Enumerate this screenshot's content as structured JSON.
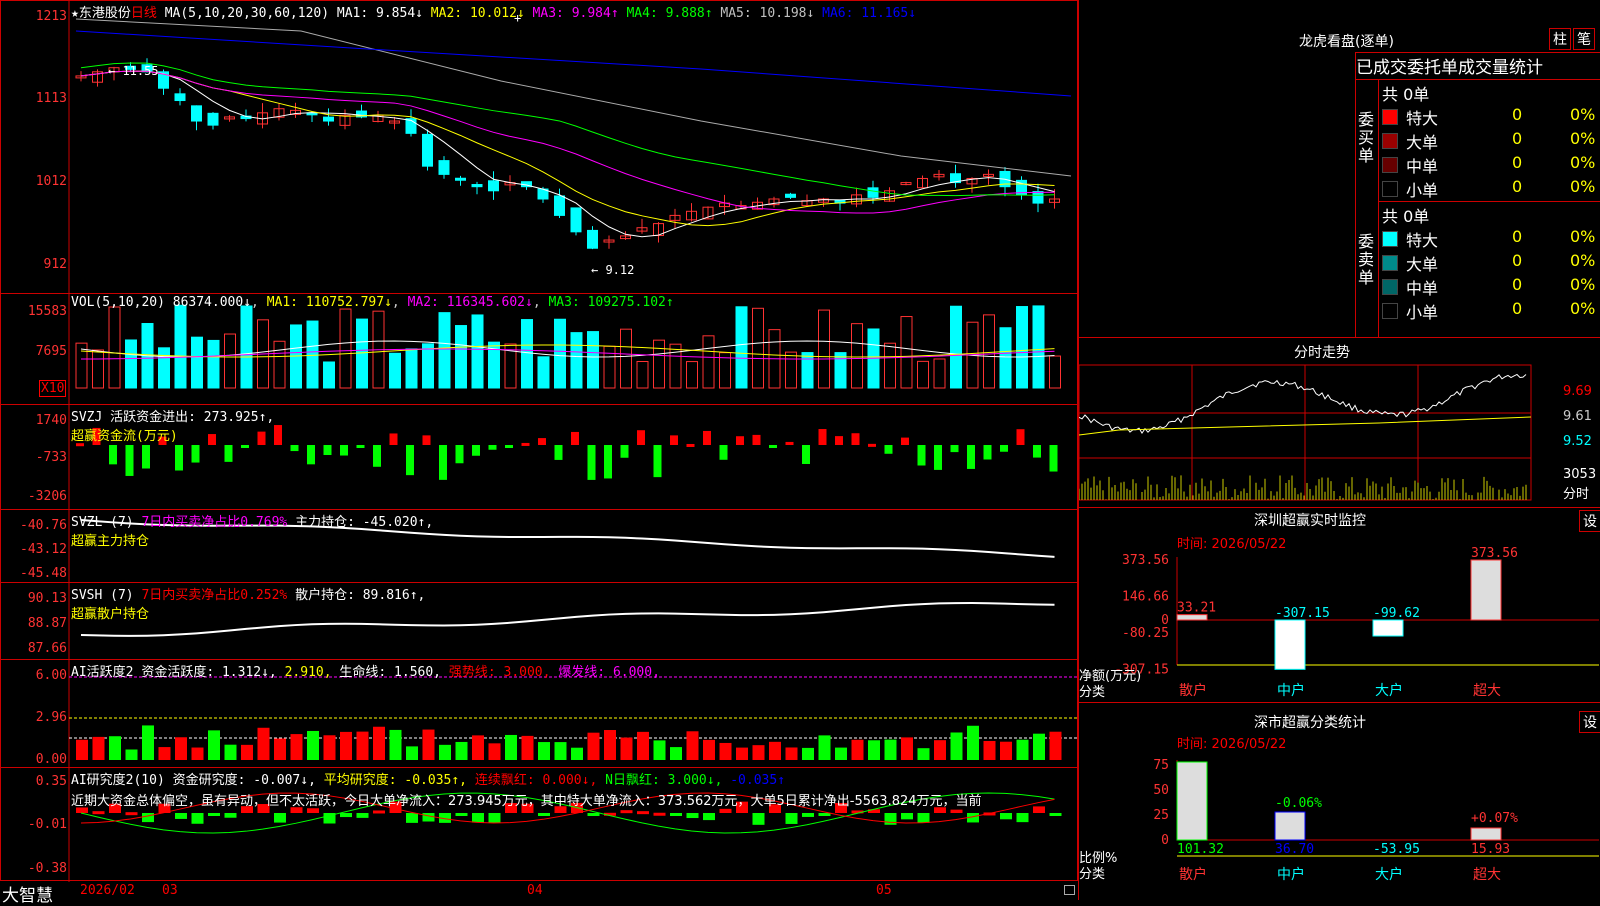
{
  "main": {
    "stock_name": "东港股份",
    "period": "日线",
    "ma_label": "MA(5,10,20,30,60,120)",
    "ma": [
      {
        "name": "MA1:",
        "value": "9.854↓",
        "color": "#ffffff"
      },
      {
        "name": "MA2:",
        "value": "10.012↓",
        "color": "#ffff00"
      },
      {
        "name": "MA3:",
        "value": "9.984↑",
        "color": "#ff00ff"
      },
      {
        "name": "MA4:",
        "value": "9.888↑",
        "color": "#00ff00"
      },
      {
        "name": "MA5:",
        "value": "10.198↓",
        "color": "#c0c0c0"
      },
      {
        "name": "MA6:",
        "value": "11.165↓",
        "color": "#0000ff"
      }
    ],
    "yticks": [
      "1213",
      "1113",
      "1012",
      "912"
    ],
    "high_label": "11.55",
    "low_label": "9.12"
  },
  "vol": {
    "label": "VOL(5,10,20)",
    "value": "86374.000↓",
    "ma1": "MA1: 110752.797↓",
    "ma2": "MA2: 116345.602↓",
    "ma3": "MA3: 109275.102↑",
    "yticks": [
      "15583",
      "7695"
    ],
    "unit": "X10"
  },
  "svzj": {
    "label": "SVZJ",
    "text": "活跃资金进出: 273.925↑,",
    "sub": "超赢资金流(万元)",
    "yticks": [
      "1740",
      "-733",
      "-3206"
    ]
  },
  "svzl": {
    "label": "SVZL (7)",
    "text1": "7日内买卖净占比0.769%",
    "text2": "主力持仓: -45.020↑,",
    "sub": "超赢主力持仓",
    "yticks": [
      "-40.76",
      "-43.12",
      "-45.48"
    ]
  },
  "svsh": {
    "label": "SVSH (7)",
    "text1": "7日内买卖净占比0.252%",
    "text2": "散户持仓: 89.816↑,",
    "sub": "超赢散户持仓",
    "yticks": [
      "90.13",
      "88.87",
      "87.66"
    ]
  },
  "ai1": {
    "label": "AI活跃度2",
    "t1": "资金活跃度: 1.312↓,",
    "t2": "2.910,",
    "t3": "生命线: 1.560,",
    "t4": "强势线: 3.000,",
    "t5": "爆发线: 6.000,",
    "yticks": [
      "6.00",
      "2.96",
      "0.00"
    ]
  },
  "ai2": {
    "label": "AI研究度2(10)",
    "t1": "资金研究度: -0.007↓,",
    "t2": "平均研究度: -0.035↑,",
    "t3": "连续飘红: 0.000↓,",
    "t4": "N日飘红: 3.000↓,",
    "t5": "-0.035↑",
    "desc": "近期大资金总体偏空，虽有异动，但不太活跃，今日大单净流入：273.945万元，其中特大单净流入：373.562万元，大单5日累计净出-5563.824万元，当前",
    "yticks": [
      "0.35",
      "-0.01",
      "-0.38"
    ]
  },
  "bottom": {
    "brand": "大智慧",
    "dates": [
      "2026/02",
      "03",
      "04",
      "05"
    ]
  },
  "right": {
    "title": "龙虎看盘(逐单)",
    "btn1": "柱",
    "btn2": "笔",
    "section_title": "已成交委托单成交量统计",
    "buy_label": "委买单",
    "sell_label": "委卖单",
    "buy_total": "共 0单",
    "sell_total": "共 0单",
    "buy_rows": [
      {
        "name": "特大",
        "count": "0",
        "pct": "0%",
        "color": "#ff0000"
      },
      {
        "name": "大单",
        "count": "0",
        "pct": "0%",
        "color": "#990000"
      },
      {
        "name": "中单",
        "count": "0",
        "pct": "0%",
        "color": "#660000"
      },
      {
        "name": "小单",
        "count": "0",
        "pct": "0%",
        "color": "#000000"
      }
    ],
    "sell_rows": [
      {
        "name": "特大",
        "count": "0",
        "pct": "0%",
        "color": "#00ffff"
      },
      {
        "name": "大单",
        "count": "0",
        "pct": "0%",
        "color": "#008b8b"
      },
      {
        "name": "中单",
        "count": "0",
        "pct": "0%",
        "color": "#006666"
      },
      {
        "name": "小单",
        "count": "0",
        "pct": "0%",
        "color": "#000000"
      }
    ],
    "intraday_title": "分时走势",
    "intraday_yticks": [
      "9.69",
      "9.61",
      "9.52"
    ],
    "intraday_vol": "3053",
    "intraday_vol_label": "分时",
    "sz_title": "深圳超赢实时监控",
    "sz_btn": "设",
    "sz_time": "时间: 2026/05/22",
    "sz_yticks": [
      "373.56",
      "146.66",
      "0",
      "-80.25",
      "-307.15"
    ],
    "sz_axis_label": "净额(万元)",
    "sz_cat_label": "分类",
    "sz_cats": [
      "散户",
      "中户",
      "大户",
      "超大"
    ],
    "sz_vals": [
      "33.21",
      "-307.15",
      "-99.62",
      "373.56"
    ],
    "sh_title": "深市超赢分类统计",
    "sh_btn": "设",
    "sh_time": "时间: 2026/05/22",
    "sh_yticks": [
      "75",
      "50",
      "25",
      "0"
    ],
    "sh_axis_label": "比例%",
    "sh_cat_label": "分类",
    "sh_pct_labels": [
      "-0.06%",
      "+0.07%"
    ],
    "sh_vals": [
      "101.32",
      "36.70",
      "-53.95",
      "15.93"
    ],
    "sh_cats": [
      "散户",
      "中户",
      "大户",
      "超大"
    ]
  }
}
